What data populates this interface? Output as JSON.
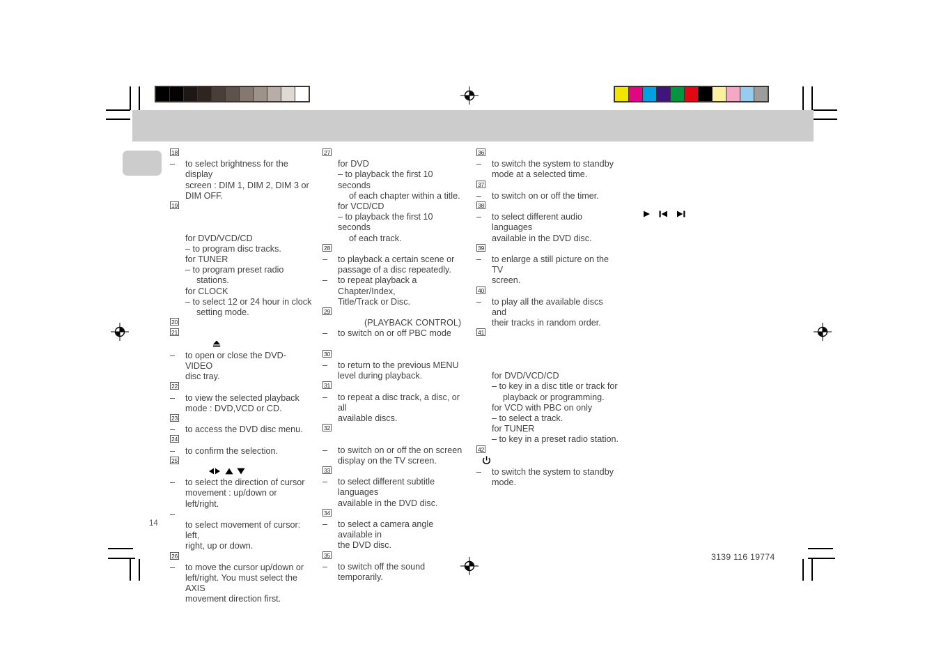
{
  "page": {
    "number": "14",
    "part_number": "3139 116 19774"
  },
  "prepress": {
    "grayscale_wedge": [
      "#000000",
      "#050203",
      "#1d1715",
      "#2e2520",
      "#4a3f38",
      "#5d524c",
      "#85796f",
      "#9e938b",
      "#b8aea7",
      "#dedad3",
      "#ffffff"
    ],
    "color_bars": [
      "#f3e500",
      "#e2077f",
      "#009fe3",
      "#40147e",
      "#009640",
      "#e30613",
      "#000000",
      "#faf0a0",
      "#f5a8c3",
      "#95ccf0",
      "#9d9d9c"
    ]
  },
  "columns": [
    {
      "id": "column-1",
      "entries": [
        {
          "number": "18",
          "lines": [
            {
              "type": "dash",
              "text": "to select brightness for the display"
            },
            {
              "type": "cont",
              "text": "screen : DIM 1, DIM 2, DIM 3 or"
            },
            {
              "type": "cont",
              "text": "DIM OFF."
            }
          ]
        },
        {
          "number": "19",
          "lines": [
            {
              "type": "blank",
              "text": ""
            },
            {
              "type": "blank",
              "text": ""
            },
            {
              "type": "head",
              "text": "for DVD/VCD/CD"
            },
            {
              "type": "sub",
              "text": "–  to program disc tracks."
            },
            {
              "type": "head",
              "text": "for TUNER"
            },
            {
              "type": "sub",
              "text": "–  to program preset radio"
            },
            {
              "type": "sub2",
              "text": "stations."
            },
            {
              "type": "head",
              "text": "for CLOCK"
            },
            {
              "type": "sub",
              "text": "–  to select 12 or 24 hour in clock"
            },
            {
              "type": "sub2",
              "text": "setting mode."
            }
          ]
        },
        {
          "number": "20",
          "lines": []
        },
        {
          "number": "21",
          "lines": [
            {
              "type": "symbol",
              "text": "eject-icon"
            },
            {
              "type": "dash",
              "text": "to open or close the DVD-VIDEO"
            },
            {
              "type": "cont",
              "text": "disc tray."
            }
          ]
        },
        {
          "number": "22",
          "lines": [
            {
              "type": "dash",
              "text": "to view the selected playback"
            },
            {
              "type": "cont",
              "text": "mode : DVD,VCD or CD."
            }
          ]
        },
        {
          "number": "23",
          "lines": [
            {
              "type": "dash",
              "text": "to access the DVD disc menu."
            }
          ]
        },
        {
          "number": "24",
          "lines": [
            {
              "type": "dash",
              "text": "to confirm the selection."
            }
          ]
        },
        {
          "number": "25",
          "lines": [
            {
              "type": "symbol",
              "text": "cursor-arrows-icon"
            },
            {
              "type": "dash",
              "text": "to select the direction of cursor"
            },
            {
              "type": "cont",
              "text": "movement : up/down or left/right."
            },
            {
              "type": "dashonly",
              "text": ""
            },
            {
              "type": "cont",
              "text": "to select movement of cursor: left,"
            },
            {
              "type": "cont",
              "text": "right, up or down."
            }
          ]
        },
        {
          "number": "26",
          "lines": [
            {
              "type": "dash",
              "text": "to move the cursor up/down or"
            },
            {
              "type": "cont",
              "text": "left/right. You must select the AXIS"
            },
            {
              "type": "cont",
              "text": "movement direction first."
            }
          ]
        }
      ]
    },
    {
      "id": "column-2",
      "entries": [
        {
          "number": "27",
          "lines": [
            {
              "type": "head",
              "text": "for DVD"
            },
            {
              "type": "sub",
              "text": "–  to playback the first 10 seconds"
            },
            {
              "type": "sub2",
              "text": "of each chapter within a title."
            },
            {
              "type": "head",
              "text": "for VCD/CD"
            },
            {
              "type": "sub",
              "text": "–  to playback the first 10 seconds"
            },
            {
              "type": "sub2",
              "text": "of each track."
            }
          ]
        },
        {
          "number": "28",
          "lines": [
            {
              "type": "dash",
              "text": "to playback a certain scene or"
            },
            {
              "type": "cont",
              "text": "passage of a disc repeatedly."
            },
            {
              "type": "dash",
              "text": "to repeat playback a Chapter/Index,"
            },
            {
              "type": "cont",
              "text": "Title/Track or Disc."
            }
          ]
        },
        {
          "number": "29",
          "lines": [
            {
              "type": "indent",
              "text": "(PLAYBACK CONTROL)"
            },
            {
              "type": "dash",
              "text": "to switch on or off PBC mode"
            },
            {
              "type": "blank",
              "text": ""
            }
          ]
        },
        {
          "number": "30",
          "lines": [
            {
              "type": "dash",
              "text": "to return to the previous MENU"
            },
            {
              "type": "cont",
              "text": "level during playback."
            }
          ]
        },
        {
          "number": "31",
          "lines": [
            {
              "type": "dash",
              "text": "to repeat a disc track, a disc, or all"
            },
            {
              "type": "cont",
              "text": "available discs."
            }
          ]
        },
        {
          "number": "32",
          "lines": [
            {
              "type": "blank",
              "text": ""
            },
            {
              "type": "dash",
              "text": "to switch on or off the on screen"
            },
            {
              "type": "cont",
              "text": "display on the TV screen."
            }
          ]
        },
        {
          "number": "33",
          "lines": [
            {
              "type": "dash",
              "text": "to select different subtitle languages"
            },
            {
              "type": "cont",
              "text": "available in the DVD disc."
            }
          ]
        },
        {
          "number": "34",
          "lines": [
            {
              "type": "dash",
              "text": "to select a camera angle available in"
            },
            {
              "type": "cont",
              "text": "the DVD disc."
            }
          ]
        },
        {
          "number": "35",
          "lines": [
            {
              "type": "dash",
              "text": "to switch off the sound temporarily."
            }
          ]
        }
      ]
    },
    {
      "id": "column-3",
      "entries": [
        {
          "number": "36",
          "lines": [
            {
              "type": "dash",
              "text": "to switch the system to standby"
            },
            {
              "type": "cont",
              "text": "mode at a selected time."
            }
          ]
        },
        {
          "number": "37",
          "lines": [
            {
              "type": "dash",
              "text": "to switch on or off the timer."
            }
          ]
        },
        {
          "number": "38",
          "lines": [
            {
              "type": "dash",
              "text": "to select different audio languages"
            },
            {
              "type": "cont",
              "text": "available in the DVD disc."
            }
          ]
        },
        {
          "number": "39",
          "lines": [
            {
              "type": "dash",
              "text": "to enlarge a still picture on the TV"
            },
            {
              "type": "cont",
              "text": "screen."
            }
          ]
        },
        {
          "number": "40",
          "lines": [
            {
              "type": "dash",
              "text": "to play all the available discs and"
            },
            {
              "type": "cont",
              "text": "their tracks in random order."
            }
          ]
        },
        {
          "number": "41",
          "lines": [
            {
              "type": "blank",
              "text": ""
            },
            {
              "type": "blank",
              "text": ""
            },
            {
              "type": "blank",
              "text": ""
            },
            {
              "type": "head",
              "text": "for DVD/VCD/CD"
            },
            {
              "type": "sub",
              "text": "–  to key in a disc title or track for"
            },
            {
              "type": "sub2",
              "text": "playback or programming."
            },
            {
              "type": "head",
              "text": "for VCD with PBC on only"
            },
            {
              "type": "sub",
              "text": "–  to select a track."
            },
            {
              "type": "head",
              "text": "for TUNER"
            },
            {
              "type": "sub",
              "text": "–  to key in a preset radio station."
            }
          ]
        },
        {
          "number": "42",
          "lines": [
            {
              "type": "symbol-left",
              "text": "power-standby-icon"
            },
            {
              "type": "dash",
              "text": "to switch the system to standby"
            },
            {
              "type": "cont",
              "text": "mode."
            }
          ]
        }
      ]
    }
  ],
  "transport_icons": [
    {
      "name": "play-icon",
      "glyph": "▶"
    },
    {
      "name": "previous-track-icon",
      "glyph": "⏮"
    },
    {
      "name": "next-track-icon",
      "glyph": "⏭"
    }
  ]
}
